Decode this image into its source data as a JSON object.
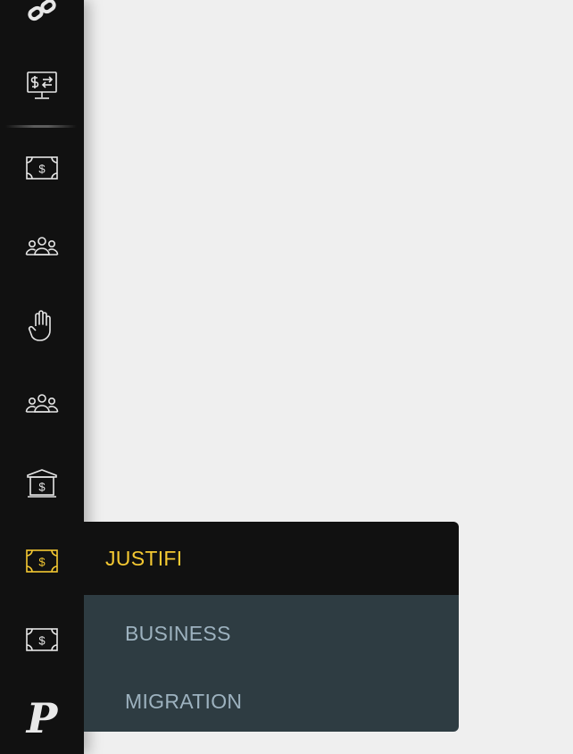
{
  "sidebar": {
    "items": [
      {
        "icon": "link-icon",
        "active": false
      },
      {
        "icon": "monitor-exchange-icon",
        "active": false
      },
      {
        "icon": "money-bill-icon",
        "active": false
      },
      {
        "icon": "group-icon",
        "active": false
      },
      {
        "icon": "hand-stop-icon",
        "active": false
      },
      {
        "icon": "group-icon",
        "active": false
      },
      {
        "icon": "bank-icon",
        "active": false
      },
      {
        "icon": "money-bill-icon",
        "active": true
      },
      {
        "icon": "money-bill-icon",
        "active": false
      }
    ],
    "brand_letter": "P"
  },
  "flyout": {
    "title": "JUSTIFI",
    "items": [
      {
        "label": "BUSINESS"
      },
      {
        "label": "MIGRATION"
      }
    ]
  },
  "colors": {
    "sidebar_bg": "#111111",
    "page_bg": "#efefef",
    "accent": "#f5c932",
    "flyout_list_bg": "#2e3c42",
    "flyout_item_text": "#9db2bf",
    "icon": "#e6e6e6"
  }
}
